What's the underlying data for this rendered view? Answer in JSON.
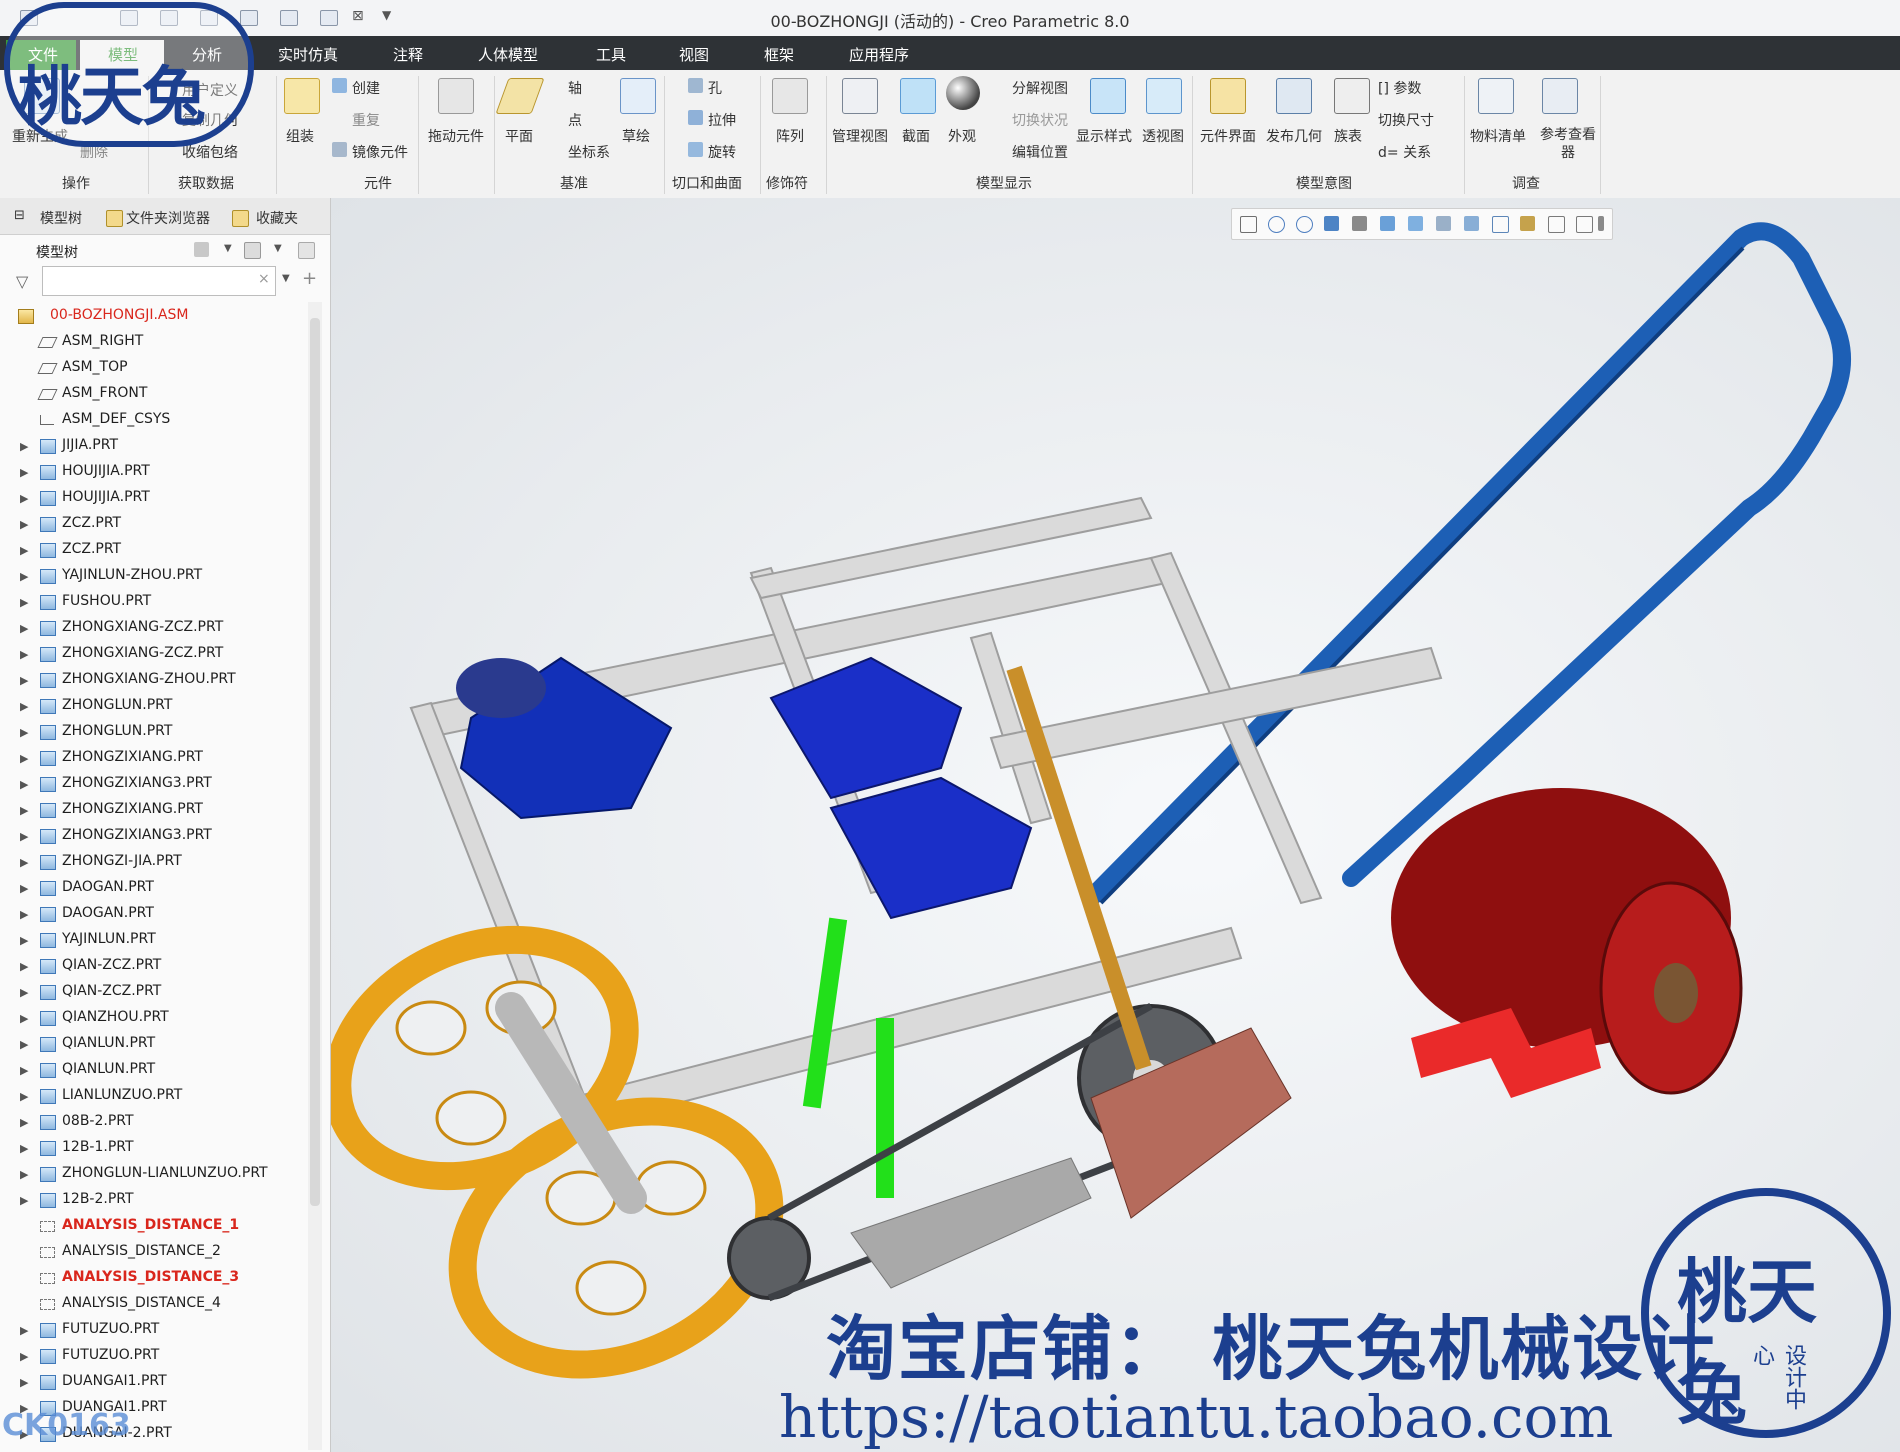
{
  "window": {
    "title": "00-BOZHONGJI (活动的) - Creo Parametric 8.0"
  },
  "menu": [
    "文件",
    "模型",
    "分析",
    "实时仿真",
    "注释",
    "人体模型",
    "工具",
    "视图",
    "框架",
    "应用程序"
  ],
  "ribbon": {
    "operations": {
      "regenerate": "重新生成",
      "delete": "删除",
      "label": "操作"
    },
    "get_data": {
      "user_defined": "用户定义",
      "copy_geometry": "复制几何",
      "shrinkwrap": "收缩包络",
      "label": "获取数据"
    },
    "component": {
      "assemble": "组装",
      "create": "创建",
      "repeat": "重复",
      "mirror": "镜像元件",
      "drag": "拖动元件",
      "label": "元件"
    },
    "datum": {
      "plane": "平面",
      "axis": "轴",
      "point": "点",
      "csys": "坐标系",
      "sketch": "草绘",
      "label": "基准"
    },
    "cut_surface": {
      "hole": "孔",
      "extrude": "拉伸",
      "revolve": "旋转",
      "label": "切口和曲面"
    },
    "modifiers": {
      "pattern": "阵列",
      "label": "修饰符"
    },
    "model_display": {
      "manage_views": "管理视图",
      "section": "截面",
      "appearance": "外观",
      "exploded_view": "分解视图",
      "toggle_state": "切换状况",
      "edit_position": "编辑位置",
      "display_style": "显示样式",
      "perspective": "透视图",
      "label": "模型显示"
    },
    "model_intent": {
      "component_interface": "元件界面",
      "publish_geometry": "发布几何",
      "family_table": "族表",
      "parameters": "参数",
      "switch_dimensions": "切换尺寸",
      "relations": "关系",
      "label": "模型意图"
    },
    "investigate": {
      "bom": "物料清单",
      "reference_viewer": "参考查看器",
      "label": "调查"
    }
  },
  "panel": {
    "tabs": [
      "模型树",
      "文件夹浏览器",
      "收藏夹"
    ],
    "tree_title": "模型树",
    "root": "00-BOZHONGJI.ASM",
    "items": [
      {
        "label": "ASM_RIGHT",
        "type": "datum"
      },
      {
        "label": "ASM_TOP",
        "type": "datum"
      },
      {
        "label": "ASM_FRONT",
        "type": "datum"
      },
      {
        "label": "ASM_DEF_CSYS",
        "type": "csys"
      },
      {
        "label": "JIJIA.PRT",
        "type": "part"
      },
      {
        "label": "HOUJIJIA.PRT",
        "type": "part"
      },
      {
        "label": "HOUJIJIA.PRT",
        "type": "part"
      },
      {
        "label": "ZCZ.PRT",
        "type": "part"
      },
      {
        "label": "ZCZ.PRT",
        "type": "part"
      },
      {
        "label": "YAJINLUN-ZHOU.PRT",
        "type": "part"
      },
      {
        "label": "FUSHOU.PRT",
        "type": "part"
      },
      {
        "label": "ZHONGXIANG-ZCZ.PRT",
        "type": "part"
      },
      {
        "label": "ZHONGXIANG-ZCZ.PRT",
        "type": "part"
      },
      {
        "label": "ZHONGXIANG-ZHOU.PRT",
        "type": "part"
      },
      {
        "label": "ZHONGLUN.PRT",
        "type": "part"
      },
      {
        "label": "ZHONGLUN.PRT",
        "type": "part"
      },
      {
        "label": "ZHONGZIXIANG.PRT",
        "type": "part"
      },
      {
        "label": "ZHONGZIXIANG3.PRT",
        "type": "part"
      },
      {
        "label": "ZHONGZIXIANG.PRT",
        "type": "part"
      },
      {
        "label": "ZHONGZIXIANG3.PRT",
        "type": "part"
      },
      {
        "label": "ZHONGZI-JIA.PRT",
        "type": "part"
      },
      {
        "label": "DAOGAN.PRT",
        "type": "part"
      },
      {
        "label": "DAOGAN.PRT",
        "type": "part"
      },
      {
        "label": "YAJINLUN.PRT",
        "type": "part"
      },
      {
        "label": "QIAN-ZCZ.PRT",
        "type": "part"
      },
      {
        "label": "QIAN-ZCZ.PRT",
        "type": "part"
      },
      {
        "label": "QIANZHOU.PRT",
        "type": "part"
      },
      {
        "label": "QIANLUN.PRT",
        "type": "part"
      },
      {
        "label": "QIANLUN.PRT",
        "type": "part"
      },
      {
        "label": "LIANLUNZUO.PRT",
        "type": "part"
      },
      {
        "label": "08B-2.PRT",
        "type": "part"
      },
      {
        "label": "12B-1.PRT",
        "type": "part"
      },
      {
        "label": "ZHONGLUN-LIANLUNZUO.PRT",
        "type": "part"
      },
      {
        "label": "12B-2.PRT",
        "type": "part"
      },
      {
        "label": "ANALYSIS_DISTANCE_1",
        "type": "analysis-error"
      },
      {
        "label": "ANALYSIS_DISTANCE_2",
        "type": "analysis"
      },
      {
        "label": "ANALYSIS_DISTANCE_3",
        "type": "analysis-error"
      },
      {
        "label": "ANALYSIS_DISTANCE_4",
        "type": "analysis"
      },
      {
        "label": "FUTUZUO.PRT",
        "type": "part"
      },
      {
        "label": "FUTUZUO.PRT",
        "type": "part"
      },
      {
        "label": "DUANGAI1.PRT",
        "type": "part"
      },
      {
        "label": "DUANGAI1.PRT",
        "type": "part"
      },
      {
        "label": "DUANGAI-2.PRT",
        "type": "part"
      }
    ]
  },
  "watermark": {
    "shop": "淘宝店铺：  桃天兔机械设计",
    "url": "https://taotiantu.taobao.com",
    "code": "CK0163",
    "logo_text": "桃天兔",
    "logo_sub": "设计中心"
  },
  "colors": {
    "accent_green": "#3a9a3a",
    "menubar": "#2e3236",
    "error_red": "#d9261c",
    "handle_blue": "#1d5fb5"
  }
}
